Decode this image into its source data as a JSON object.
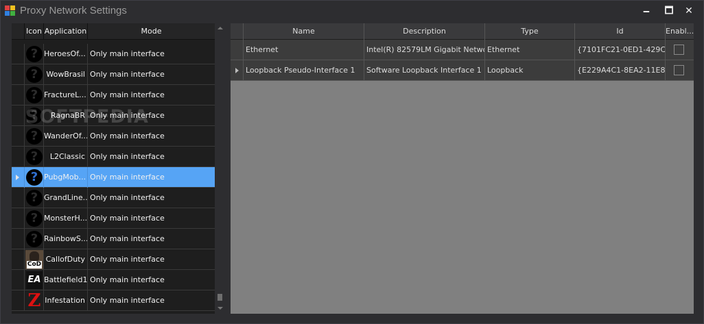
{
  "window": {
    "title": "Proxy Network Settings",
    "minimize_glyph": "🗕",
    "maximize_glyph": "🗖",
    "close_glyph": "✕"
  },
  "applications": {
    "columns": [
      "Icon",
      "Application",
      "Mode"
    ],
    "rows": [
      {
        "icon": "question-icon",
        "name": "HeroesOf...",
        "mode": "Only main interface"
      },
      {
        "icon": "question-icon",
        "name": "WowBrasil",
        "mode": "Only main interface"
      },
      {
        "icon": "question-icon",
        "name": "FractureL...",
        "mode": "Only main interface"
      },
      {
        "icon": "question-icon",
        "name": "RagnaBR",
        "mode": "Only main interface"
      },
      {
        "icon": "question-icon",
        "name": "WanderOf...",
        "mode": "Only main interface"
      },
      {
        "icon": "question-icon",
        "name": "L2Classic",
        "mode": "Only main interface"
      },
      {
        "icon": "question-icon",
        "name": "PubgMob...",
        "mode": "Only main interface",
        "selected": true
      },
      {
        "icon": "question-icon",
        "name": "GrandLine...",
        "mode": "Only main interface"
      },
      {
        "icon": "question-icon",
        "name": "MonsterH...",
        "mode": "Only main interface"
      },
      {
        "icon": "question-icon",
        "name": "RainbowS...",
        "mode": "Only main interface"
      },
      {
        "icon": "cod-icon",
        "name": "CallofDuty",
        "mode": "Only main interface"
      },
      {
        "icon": "ea-icon",
        "name": "Battlefield1",
        "mode": "Only main interface"
      },
      {
        "icon": "z-icon",
        "name": "Infestation",
        "mode": "Only main interface"
      }
    ]
  },
  "icons": {
    "question_glyph": "?",
    "cod_text": "CoD",
    "ea_text": "EA",
    "z_text": "Z"
  },
  "interfaces": {
    "columns": [
      "Name",
      "Description",
      "Type",
      "Id",
      "Enabl..."
    ],
    "rows": [
      {
        "name": "Ethernet",
        "description": "Intel(R) 82579LM Gigabit Netwo...",
        "type": "Ethernet",
        "id": "{7101FC21-0ED1-429C-...",
        "enabled": false
      },
      {
        "name": "Loopback Pseudo-Interface 1",
        "description": "Software Loopback Interface 1",
        "type": "Loopback",
        "id": "{E229A4C1-8EA2-11E8-...",
        "enabled": false
      }
    ]
  },
  "watermark": "SOFTPEDIA",
  "colors": {
    "selection": "#56a4f5",
    "window_bg": "#2d2d30",
    "right_grid_bg": "#808080"
  }
}
